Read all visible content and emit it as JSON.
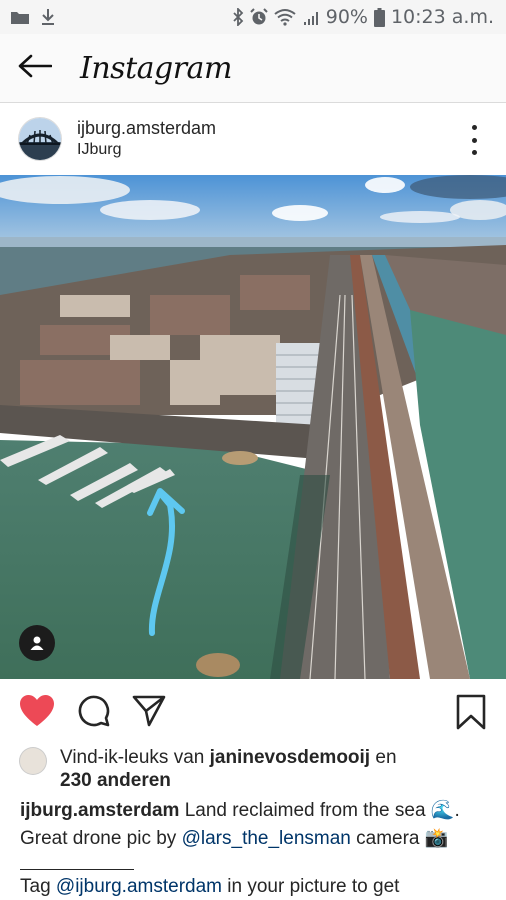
{
  "status_bar": {
    "battery": "90%",
    "time": "10:23 a.m."
  },
  "app_bar": {
    "title": "Instagram"
  },
  "post": {
    "username": "ijburg.amsterdam",
    "location": "IJburg",
    "likes_prefix": "Vind-ik-leuks van ",
    "liked_by": "janinevosdemooij",
    "likes_joiner": " en",
    "others": "230 anderen",
    "caption_user": "ijburg.amsterdam",
    "caption_text": " Land reclaimed from the sea 🌊.",
    "caption_line2_prefix": "Great drone pic by ",
    "caption_mention": "@lars_the_lensman",
    "caption_line2_suffix": " camera 📸",
    "tag_prefix": "Tag ",
    "tag_mention": "@ijburg.amsterdam",
    "tag_suffix": " in your picture to get"
  },
  "icons": {
    "heart": "heart-icon",
    "comment": "comment-icon",
    "share": "share-icon",
    "save": "bookmark-icon"
  },
  "colors": {
    "like_red": "#ed4956",
    "mention_blue": "#003569",
    "arrow_blue": "#5ec8f0"
  }
}
